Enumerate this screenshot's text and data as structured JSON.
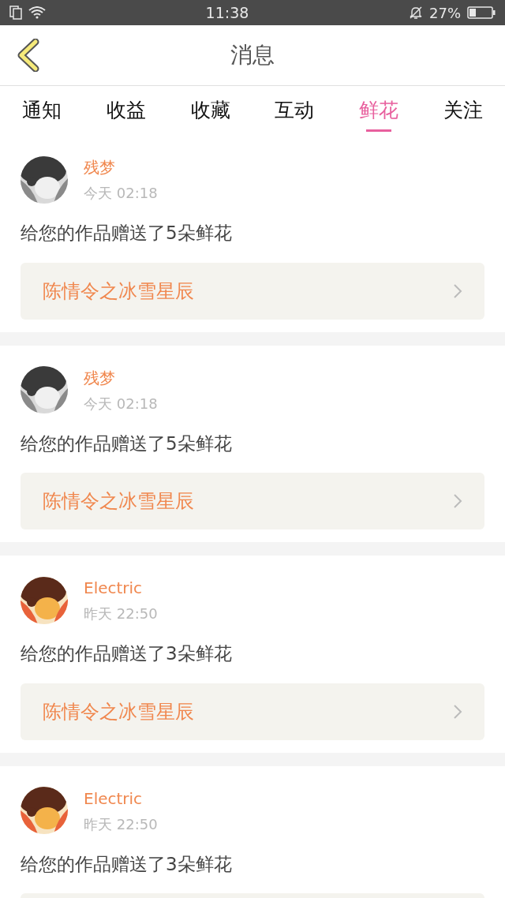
{
  "status_bar": {
    "time": "11:38",
    "battery": "27%"
  },
  "header": {
    "title": "消息"
  },
  "tabs": [
    {
      "label": "通知",
      "selected": false
    },
    {
      "label": "收益",
      "selected": false
    },
    {
      "label": "收藏",
      "selected": false
    },
    {
      "label": "互动",
      "selected": false
    },
    {
      "label": "鲜花",
      "selected": true
    },
    {
      "label": "关注",
      "selected": false
    }
  ],
  "messages": [
    {
      "user": "残梦",
      "time": "今天 02:18",
      "text": "给您的作品赠送了5朵鲜花",
      "work_title": "陈情令之冰雪星辰"
    },
    {
      "user": "残梦",
      "time": "今天 02:18",
      "text": "给您的作品赠送了5朵鲜花",
      "work_title": "陈情令之冰雪星辰"
    },
    {
      "user": "Electric",
      "time": "昨天 22:50",
      "text": "给您的作品赠送了3朵鲜花",
      "work_title": "陈情令之冰雪星辰"
    },
    {
      "user": "Electric",
      "time": "昨天 22:50",
      "text": "给您的作品赠送了3朵鲜花"
    }
  ]
}
